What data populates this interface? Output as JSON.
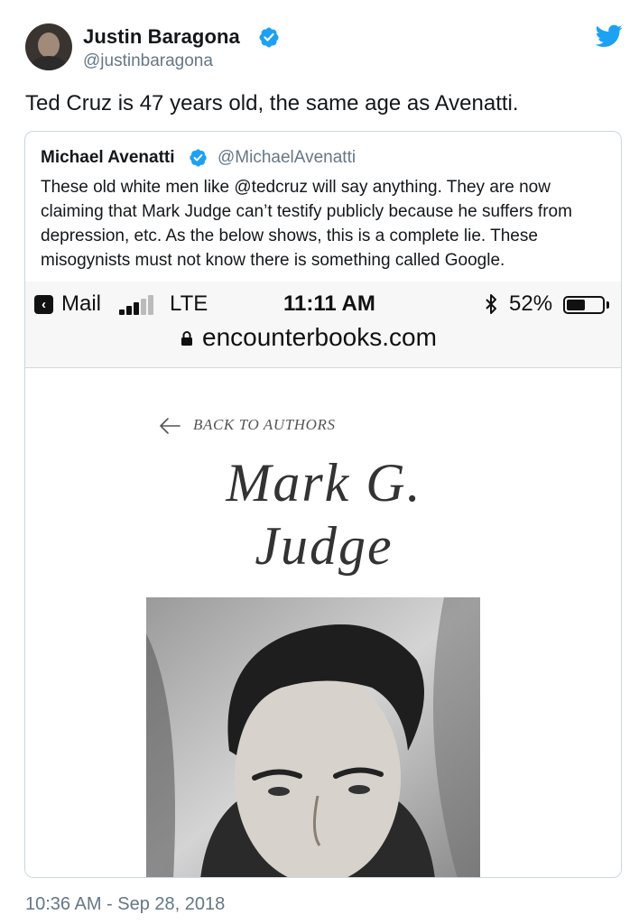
{
  "tweet": {
    "author_name": "Justin Baragona",
    "author_handle": "@justinbaragona",
    "text": "Ted Cruz is 47 years old, the same age as Avenatti.",
    "timestamp": "10:36 AM - Sep 28, 2018"
  },
  "quoted_tweet": {
    "author_name": "Michael Avenatti",
    "author_handle": "@MichaelAvenatti",
    "text": "These old white men like @tedcruz will say anything. They are now claiming that Mark Judge can’t testify publicly because he suffers from depression, etc. As the below shows, this is a complete lie. These misogynists must not know there is something called Google."
  },
  "screenshot": {
    "status_bar": {
      "back_app": "Mail",
      "network": "LTE",
      "time": "11:11 AM",
      "battery_percent_label": "52%",
      "battery_level": 0.52
    },
    "url": "encounterbooks.com",
    "back_link": "BACK TO AUTHORS",
    "author_title_line1": "Mark G.",
    "author_title_line2": "Judge"
  },
  "colors": {
    "twitter_blue": "#1da1f2",
    "secondary_text": "#657786",
    "border": "#ccd6dd"
  },
  "icons": {
    "verified": "verified-badge-icon",
    "twitter": "twitter-bird-icon",
    "lock": "lock-icon",
    "bluetooth": "bluetooth-icon",
    "back_arrow": "left-arrow-icon"
  }
}
